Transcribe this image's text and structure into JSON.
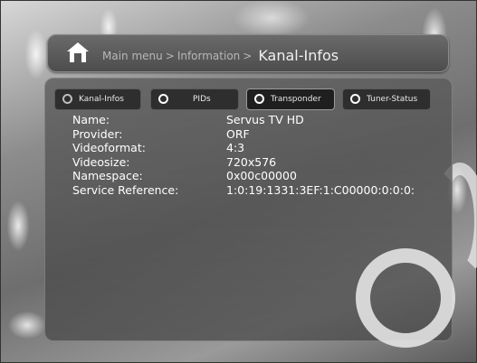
{
  "header": {
    "breadcrumb": [
      "Main menu",
      "Information"
    ],
    "separator": ">",
    "title": "Kanal-Infos"
  },
  "tabs": [
    {
      "label": "Kanal-Infos"
    },
    {
      "label": "PIDs"
    },
    {
      "label": "Transponder"
    },
    {
      "label": "Tuner-Status"
    }
  ],
  "info": [
    {
      "key": "Name:",
      "value": "Servus TV HD"
    },
    {
      "key": "Provider:",
      "value": "ORF"
    },
    {
      "key": "Videoformat:",
      "value": "4:3"
    },
    {
      "key": "Videosize:",
      "value": "720x576"
    },
    {
      "key": "Namespace:",
      "value": "0x00c00000"
    },
    {
      "key": "Service Reference:",
      "value": "1:0:19:1331:3EF:1:C00000:0:0:0:"
    }
  ]
}
